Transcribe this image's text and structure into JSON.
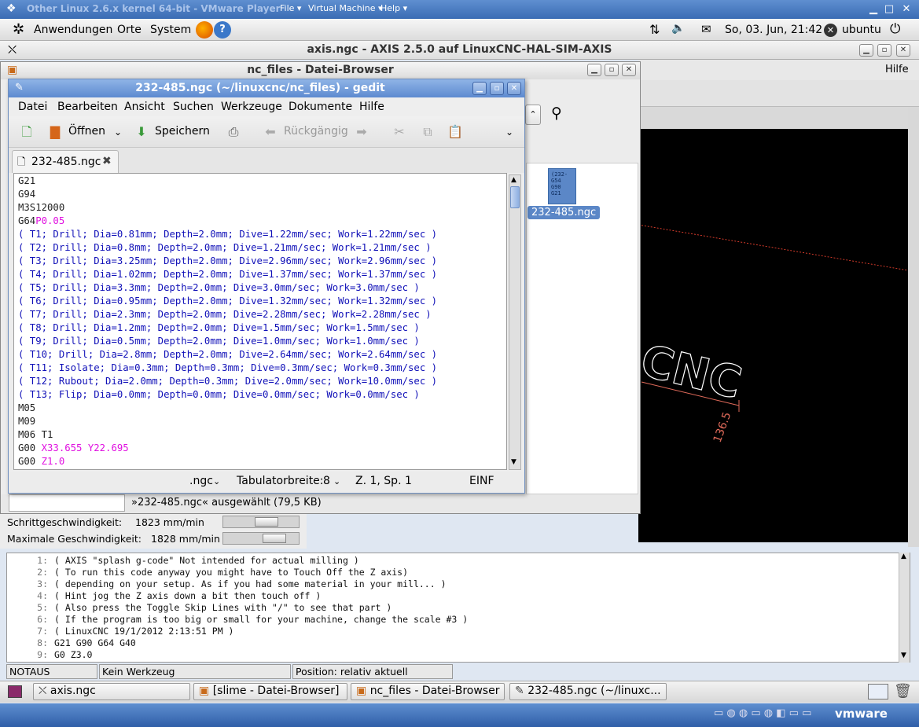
{
  "vmware": {
    "title": "Other Linux 2.6.x kernel 64-bit - VMware Player",
    "menu": [
      "File ▾",
      "Virtual Machine ▾",
      "Help ▾"
    ],
    "brand": "vmware"
  },
  "gnome_panel": {
    "menus": [
      "Anwendungen",
      "Orte",
      "System"
    ],
    "datetime": "So, 03. Jun, 21:42",
    "user": "ubuntu"
  },
  "axis": {
    "title": "axis.ngc - AXIS 2.5.0 auf  LinuxCNC-HAL-SIM-AXIS",
    "menu_help": "Hilfe",
    "preview_label": "CNC",
    "dimension": "136.5",
    "speed": [
      {
        "label": "Schrittgeschwindigkeit:",
        "value": "1823 mm/min",
        "fraction": 0.6
      },
      {
        "label": "Maximale Geschwindigkeit:",
        "value": "1828 mm/min",
        "fraction": 0.75
      }
    ],
    "gcode_lines": [
      {
        "n": "1:",
        "text": "( AXIS \"splash g-code\" Not intended for actual milling )"
      },
      {
        "n": "2:",
        "text": "( To run this code anyway you might have to Touch Off the Z axis)"
      },
      {
        "n": "3:",
        "text": "( depending on your setup. As if you had some material in your mill... )"
      },
      {
        "n": "4:",
        "text": "( Hint jog the Z axis down a bit then touch off )"
      },
      {
        "n": "5:",
        "text": "( Also press the Toggle Skip Lines with \"/\" to see that part )"
      },
      {
        "n": "6:",
        "text": "( If the program is too big or small for your machine, change the scale #3 )"
      },
      {
        "n": "7:",
        "text": "( LinuxCNC 19/1/2012 2:13:51 PM )"
      },
      {
        "n": "8:",
        "text": "G21 G90 G64 G40"
      },
      {
        "n": "9:",
        "text": "G0 Z3.0"
      }
    ],
    "status": [
      "NOTAUS",
      "Kein Werkzeug",
      "Position: relativ aktuell"
    ]
  },
  "filebrowser": {
    "title": "nc_files - Datei-Browser",
    "file_name": "232-485.ngc",
    "file_thumb": [
      "(232-",
      "G54",
      "G90",
      "G21"
    ],
    "status": "»232-485.ngc« ausgewählt (79,5 KB)"
  },
  "gedit": {
    "title": "232-485.ngc (~/linuxcnc/nc_files) - gedit",
    "menu": [
      "Datei",
      "Bearbeiten",
      "Ansicht",
      "Suchen",
      "Werkzeuge",
      "Dokumente",
      "Hilfe"
    ],
    "toolbar": {
      "open": "Öffnen",
      "save": "Speichern",
      "undo": "Rückgängig"
    },
    "tab": "232-485.ngc",
    "lines": [
      [
        {
          "t": "G21",
          "c": "blk"
        }
      ],
      [
        {
          "t": "G94",
          "c": "blk"
        }
      ],
      [
        {
          "t": "M3S12000",
          "c": "blk"
        }
      ],
      [
        {
          "t": "G64",
          "c": "blk"
        },
        {
          "t": "P0.05",
          "c": "mag"
        }
      ],
      [
        {
          "t": "( T1; Drill; Dia=0.81mm; Depth=2.0mm; Dive=1.22mm/sec; Work=1.22mm/sec )",
          "c": "blue"
        }
      ],
      [
        {
          "t": "( T2; Drill; Dia=0.8mm; Depth=2.0mm; Dive=1.21mm/sec; Work=1.21mm/sec )",
          "c": "blue"
        }
      ],
      [
        {
          "t": "( T3; Drill; Dia=3.25mm; Depth=2.0mm; Dive=2.96mm/sec; Work=2.96mm/sec )",
          "c": "blue"
        }
      ],
      [
        {
          "t": "( T4; Drill; Dia=1.02mm; Depth=2.0mm; Dive=1.37mm/sec; Work=1.37mm/sec )",
          "c": "blue"
        }
      ],
      [
        {
          "t": "( T5; Drill; Dia=3.3mm; Depth=2.0mm; Dive=3.0mm/sec; Work=3.0mm/sec )",
          "c": "blue"
        }
      ],
      [
        {
          "t": "( T6; Drill; Dia=0.95mm; Depth=2.0mm; Dive=1.32mm/sec; Work=1.32mm/sec )",
          "c": "blue"
        }
      ],
      [
        {
          "t": "( T7; Drill; Dia=2.3mm; Depth=2.0mm; Dive=2.28mm/sec; Work=2.28mm/sec )",
          "c": "blue"
        }
      ],
      [
        {
          "t": "( T8; Drill; Dia=1.2mm; Depth=2.0mm; Dive=1.5mm/sec; Work=1.5mm/sec )",
          "c": "blue"
        }
      ],
      [
        {
          "t": "( T9; Drill; Dia=0.5mm; Depth=2.0mm; Dive=1.0mm/sec; Work=1.0mm/sec )",
          "c": "blue"
        }
      ],
      [
        {
          "t": "( T10; Drill; Dia=2.8mm; Depth=2.0mm; Dive=2.64mm/sec; Work=2.64mm/sec )",
          "c": "blue"
        }
      ],
      [
        {
          "t": "( T11; Isolate; Dia=0.3mm; Depth=0.3mm; Dive=0.3mm/sec; Work=0.3mm/sec )",
          "c": "blue"
        }
      ],
      [
        {
          "t": "( T12; Rubout; Dia=2.0mm; Depth=0.3mm; Dive=2.0mm/sec; Work=10.0mm/sec )",
          "c": "blue"
        }
      ],
      [
        {
          "t": "( T13; Flip; Dia=0.0mm; Depth=0.0mm; Dive=0.0mm/sec; Work=0.0mm/sec )",
          "c": "blue"
        }
      ],
      [
        {
          "t": "M05",
          "c": "blk"
        }
      ],
      [
        {
          "t": "M09",
          "c": "blk"
        }
      ],
      [
        {
          "t": "M06 T1",
          "c": "blk"
        }
      ],
      [
        {
          "t": "G00 ",
          "c": "blk"
        },
        {
          "t": "X33.655 Y22.695",
          "c": "mag"
        }
      ],
      [
        {
          "t": "G00 ",
          "c": "blk"
        },
        {
          "t": "Z1.0",
          "c": "mag"
        }
      ]
    ],
    "status": {
      "lang": ".ngc",
      "tab_label": "Tabulatorbreite:",
      "tab_width": "8",
      "position": "Z. 1, Sp. 1",
      "mode": "EINF"
    }
  },
  "taskbar": [
    {
      "label": "axis.ngc",
      "icon": "axis-icon"
    },
    {
      "label": "[slime - Datei-Browser]",
      "icon": "folder-icon"
    },
    {
      "label": "nc_files - Datei-Browser",
      "icon": "folder-icon"
    },
    {
      "label": "232-485.ngc (~/linuxc...",
      "icon": "text-editor-icon"
    }
  ]
}
